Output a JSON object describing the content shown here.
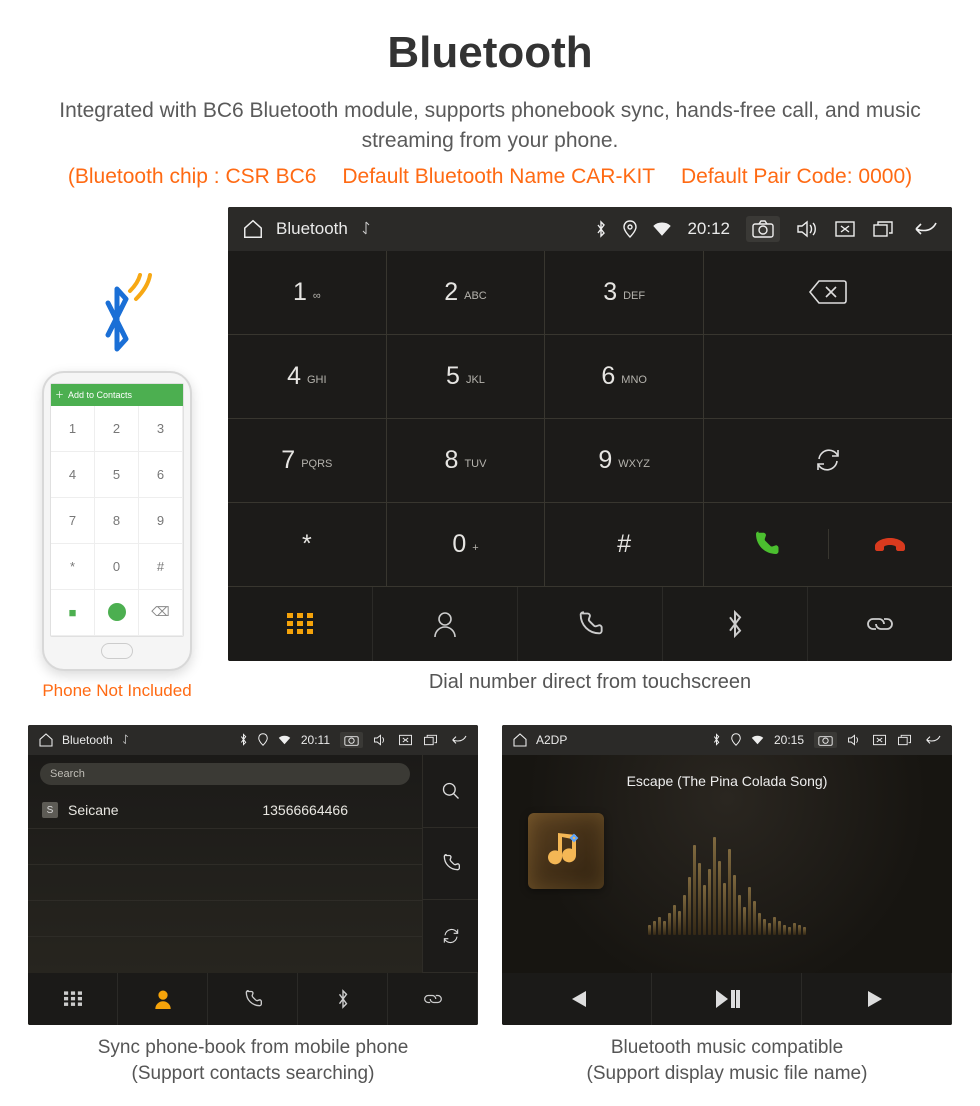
{
  "title": "Bluetooth",
  "subtitle": "Integrated with BC6 Bluetooth module, supports phonebook sync, hands-free call, and music streaming from your phone.",
  "spec": {
    "chip": "(Bluetooth chip : CSR BC6",
    "name": "Default Bluetooth Name CAR-KIT",
    "code": "Default Pair Code: 0000)"
  },
  "phone_caption": "Phone Not Included",
  "phone_add_contacts": "Add to Contacts",
  "main": {
    "status": {
      "app": "Bluetooth",
      "time": "20:12"
    },
    "keys": [
      {
        "n": "1",
        "s": "∞"
      },
      {
        "n": "2",
        "s": "ABC"
      },
      {
        "n": "3",
        "s": "DEF"
      },
      {
        "n": "4",
        "s": "GHI"
      },
      {
        "n": "5",
        "s": "JKL"
      },
      {
        "n": "6",
        "s": "MNO"
      },
      {
        "n": "7",
        "s": "PQRS"
      },
      {
        "n": "8",
        "s": "TUV"
      },
      {
        "n": "9",
        "s": "WXYZ"
      },
      {
        "n": "*",
        "s": ""
      },
      {
        "n": "0",
        "s": "+"
      },
      {
        "n": "#",
        "s": ""
      }
    ],
    "caption": "Dial number direct from touchscreen"
  },
  "contacts": {
    "status": {
      "app": "Bluetooth",
      "time": "20:11"
    },
    "search_placeholder": "Search",
    "rows": [
      {
        "initial": "S",
        "name": "Seicane",
        "number": "13566664466"
      }
    ],
    "caption_line1": "Sync phone-book from mobile phone",
    "caption_line2": "(Support contacts searching)"
  },
  "music": {
    "status": {
      "app": "A2DP",
      "time": "20:15"
    },
    "track": "Escape (The Pina Colada Song)",
    "caption_line1": "Bluetooth music compatible",
    "caption_line2": "(Support display music file name)"
  }
}
